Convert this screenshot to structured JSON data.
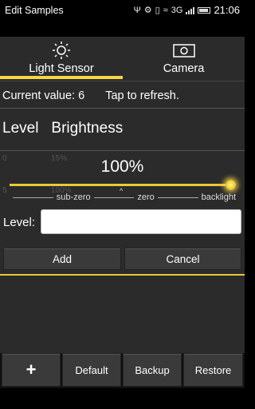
{
  "statusbar": {
    "app_title": "Edit Samples",
    "network_label": "3G",
    "time": "21:06"
  },
  "tabs": [
    {
      "label": "Light Sensor",
      "icon": "sun-icon",
      "active": true
    },
    {
      "label": "Camera",
      "icon": "camera-icon",
      "active": false
    }
  ],
  "sensor": {
    "current_value": "Current value: 6",
    "tap_hint": "Tap to refresh."
  },
  "columns": {
    "level": "Level",
    "brightness": "Brightness"
  },
  "background_table": {
    "r1c1": "0",
    "r1c2": "15%",
    "r2c1": "5",
    "r2c2": "100%"
  },
  "slider": {
    "percent": "100%",
    "value_fraction": 1.0,
    "scale_left": "sub-zero",
    "scale_mid": "zero",
    "scale_right": "backlight"
  },
  "form": {
    "level_label": "Level:",
    "level_value": "",
    "add_label": "Add",
    "cancel_label": "Cancel"
  },
  "bottom": {
    "add_label": "+",
    "default_label": "Default",
    "backup_label": "Backup",
    "restore_label": "Restore"
  },
  "colors": {
    "accent": "#f3d44a",
    "panel": "#2b2b2b"
  }
}
